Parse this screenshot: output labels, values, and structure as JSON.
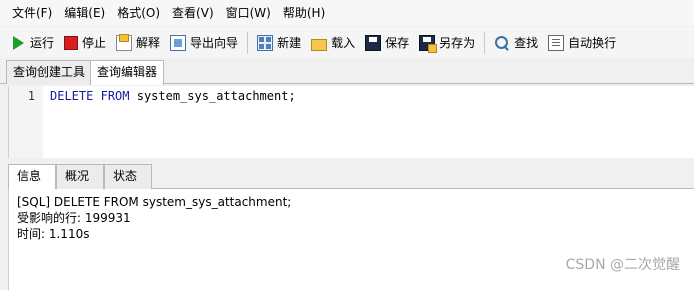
{
  "menu": [
    "文件(F)",
    "编辑(E)",
    "格式(O)",
    "查看(V)",
    "窗口(W)",
    "帮助(H)"
  ],
  "toolbar": {
    "run": "运行",
    "stop": "停止",
    "explain": "解释",
    "export_wizard": "导出向导",
    "new": "新建",
    "load": "载入",
    "save": "保存",
    "save_as": "另存为",
    "find": "查找",
    "word_wrap": "自动换行"
  },
  "top_tabs": [
    "查询创建工具",
    "查询编辑器"
  ],
  "editor": {
    "line_number": "1",
    "keyword1": "DELETE",
    "keyword2": "FROM",
    "rest": " system_sys_attachment;"
  },
  "result_tabs": [
    "信息",
    "概况",
    "状态"
  ],
  "result": {
    "line1": "[SQL] DELETE FROM system_sys_attachment;",
    "line2": "受影响的行: 199931",
    "line3": "时间: 1.110s"
  },
  "watermark": "CSDN @二次觉醒",
  "colors": {
    "keyword": "#1a1aa6",
    "run_icon": "#1f9e2a",
    "stop_icon": "#d81e1e"
  }
}
